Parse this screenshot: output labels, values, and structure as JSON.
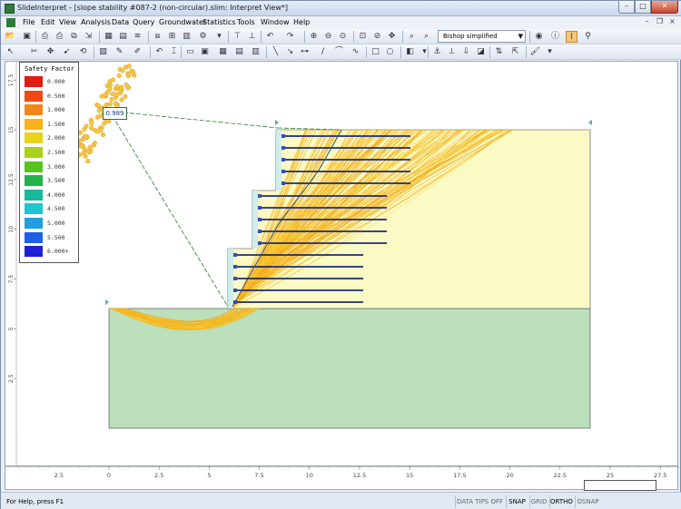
{
  "window": {
    "title": "SlideInterpret - [slope stability #087-2 (non-circular).slim: Interpret View*]",
    "minimize": "–",
    "maximize": "□",
    "close": "✕"
  },
  "menu": {
    "items": [
      "File",
      "Edit",
      "View",
      "Analysis",
      "Data",
      "Query",
      "Groundwater",
      "Statistics",
      "Tools",
      "Window",
      "Help"
    ],
    "mdi_minimize": "–",
    "mdi_restore": "❐",
    "mdi_close": "×"
  },
  "toolbar": {
    "method": "Bishop simplified"
  },
  "legend": {
    "title": "Safety Factor",
    "entries": [
      {
        "label": "0.000",
        "color": "#e01b10"
      },
      {
        "label": "0.500",
        "color": "#ee4a12"
      },
      {
        "label": "1.000",
        "color": "#f3861a"
      },
      {
        "label": "1.500",
        "color": "#f9b21c"
      },
      {
        "label": "2.000",
        "color": "#e6d516"
      },
      {
        "label": "2.500",
        "color": "#a8d11a"
      },
      {
        "label": "3.000",
        "color": "#57c21f"
      },
      {
        "label": "3.500",
        "color": "#22b24a"
      },
      {
        "label": "4.000",
        "color": "#19b89a"
      },
      {
        "label": "4.500",
        "color": "#1ec4cf"
      },
      {
        "label": "5.000",
        "color": "#1f9fe0"
      },
      {
        "label": "5.500",
        "color": "#1e5fe6"
      },
      {
        "label": "6.000+",
        "color": "#1f1fd6"
      }
    ]
  },
  "model": {
    "min_factor_of_safety": "0.989",
    "colors": {
      "upper_material": "#fbf9c4",
      "lower_material": "#bcdfbc",
      "facing": "#c9ecf0",
      "nail": "#1b2a7a",
      "slip_surface": "#f5b81f",
      "critical_line": "#2a7a2a"
    }
  },
  "axes": {
    "x_ticks": [
      "2.5",
      "5",
      "7.5",
      "10",
      "12.5",
      "15",
      "17.5",
      "20",
      "22.5",
      "25",
      "27.5"
    ],
    "x_zero_label": "0",
    "y_ticks": [
      "2.5",
      "5",
      "7.5",
      "10",
      "12.5",
      "15",
      "17.5"
    ]
  },
  "status": {
    "text": "For Help, press F1",
    "cells": [
      {
        "label": "DATA TIPS OFF",
        "on": false
      },
      {
        "label": "SNAP",
        "on": true
      },
      {
        "label": "GRID",
        "on": false
      },
      {
        "label": "ORTHO",
        "on": true
      },
      {
        "label": "OSNAP",
        "on": false
      }
    ]
  }
}
